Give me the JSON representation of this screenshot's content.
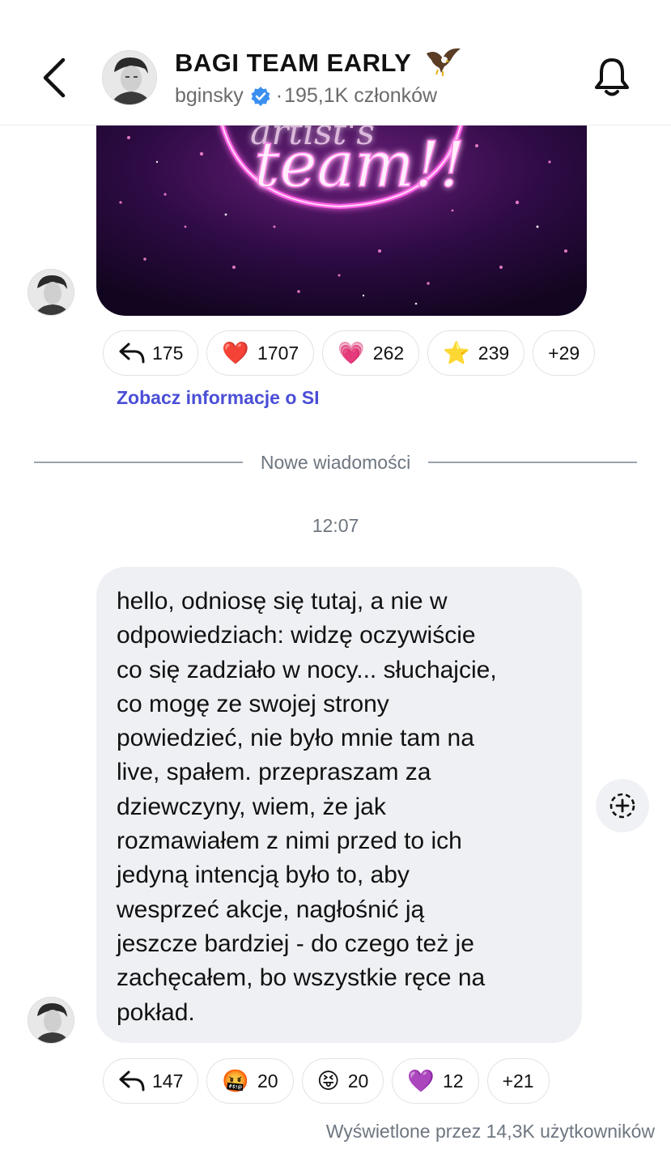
{
  "header": {
    "title": "BAGI TEAM EARLY",
    "owner": "bginsky",
    "separator": "·",
    "members": "195,1K członków",
    "title_icon": "eagle-icon",
    "verified_icon": "verified-badge-icon",
    "back_icon": "chevron-left-icon",
    "bell_icon": "bell-icon"
  },
  "messages": [
    {
      "type": "image",
      "image_text": "team!!",
      "reactions": [
        {
          "icon": "reply-icon",
          "emoji": "",
          "count": "175"
        },
        {
          "icon": "red-heart-icon",
          "emoji": "❤️",
          "count": "1707"
        },
        {
          "icon": "sparkling-heart-icon",
          "emoji": "💗",
          "count": "262"
        },
        {
          "icon": "star-icon",
          "emoji": "⭐",
          "count": "239"
        },
        {
          "icon": "",
          "emoji": "",
          "count": "+29"
        }
      ],
      "ai_info_link": "Zobacz informacje o SI"
    },
    {
      "type": "text",
      "text": "hello, odniosę się tutaj, a nie w\nodpowiedziach: widzę oczywiście\nco się zadziało w nocy... słuchajcie,\nco mogę ze swojej strony\npowiedzieć, nie było mnie tam na\nlive, spałem. przepraszam za\ndziewczyny, wiem, że jak\nrozmawiałem z nimi przed to ich\njedyną intencją było to, aby\nwesprzeć akcje, nagłośnić ją\njeszcze bardziej - do czego też je\nzachęcałem, bo wszystkie ręce na\npokład.",
      "reactions": [
        {
          "icon": "reply-icon",
          "emoji": "",
          "count": "147"
        },
        {
          "icon": "cursing-face-icon",
          "emoji": "🤬",
          "count": "20"
        },
        {
          "icon": "squinting-tongue-face-icon",
          "emoji": "😝",
          "count": "20"
        },
        {
          "icon": "purple-heart-icon",
          "emoji": "💜",
          "count": "12"
        },
        {
          "icon": "",
          "emoji": "",
          "count": "+21"
        }
      ],
      "views": "Wyświetlone przez 14,3K użytkowników"
    }
  ],
  "divider_label": "Nowe wiadomości",
  "timestamp": "12:07",
  "colors": {
    "link": "#4a4ed6",
    "bubble": "#eff0f4",
    "muted": "#6e7680",
    "verified": "#3b8ff0",
    "neon": "#ff6fe8"
  }
}
